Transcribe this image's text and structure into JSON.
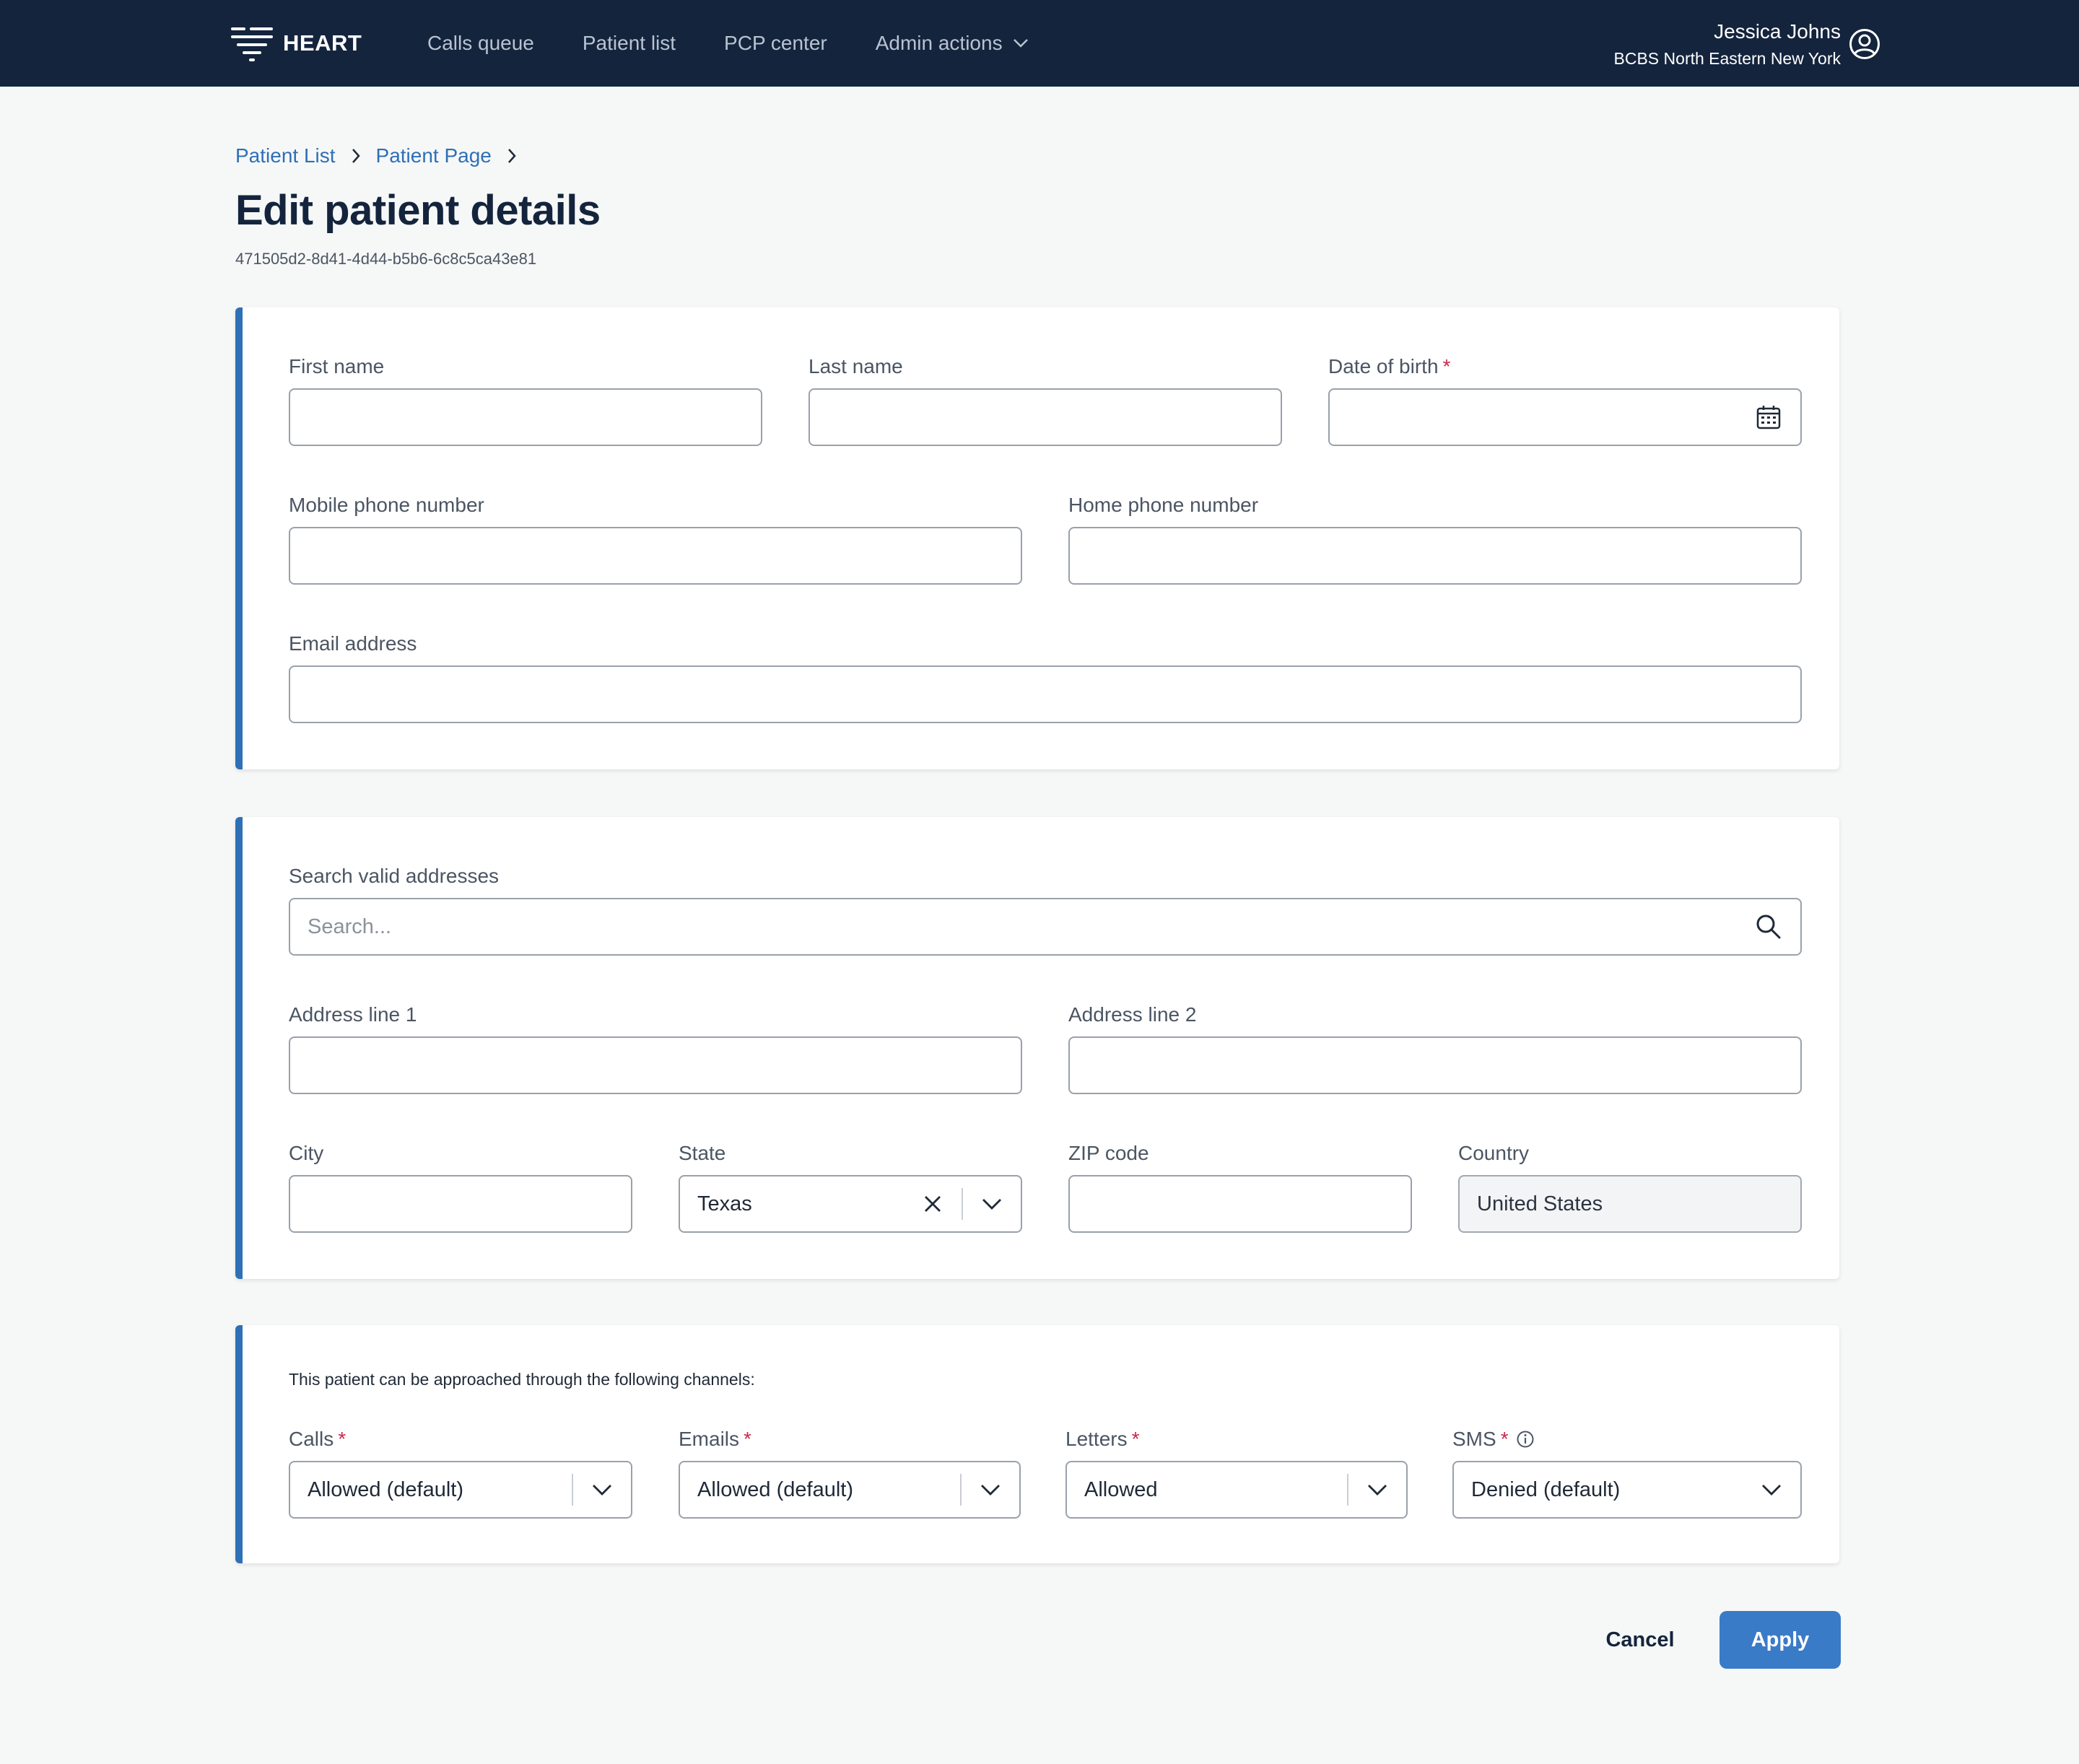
{
  "app": {
    "name": "HEART"
  },
  "nav": {
    "items": [
      {
        "label": "Calls queue"
      },
      {
        "label": "Patient list"
      },
      {
        "label": "PCP center"
      },
      {
        "label": "Admin actions"
      }
    ]
  },
  "user": {
    "name": "Jessica Johns",
    "org": "BCBS North Eastern New York"
  },
  "breadcrumb": {
    "items": [
      "Patient List",
      "Patient Page"
    ]
  },
  "page": {
    "title": "Edit patient details",
    "patient_id": "471505d2-8d41-4d44-b5b6-6c8c5ca43e81"
  },
  "personal": {
    "first_name": {
      "label": "First name",
      "value": ""
    },
    "last_name": {
      "label": "Last name",
      "value": ""
    },
    "dob": {
      "label": "Date of birth",
      "required": "*",
      "value": ""
    },
    "mobile": {
      "label": "Mobile phone number",
      "value": ""
    },
    "home": {
      "label": "Home phone number",
      "value": ""
    },
    "email": {
      "label": "Email address",
      "value": ""
    }
  },
  "address": {
    "search": {
      "label": "Search valid addresses",
      "placeholder": "Search..."
    },
    "line1": {
      "label": "Address line 1",
      "value": ""
    },
    "line2": {
      "label": "Address line 2",
      "value": ""
    },
    "city": {
      "label": "City",
      "value": ""
    },
    "state": {
      "label": "State",
      "value": "Texas"
    },
    "zip": {
      "label": "ZIP code",
      "value": ""
    },
    "country": {
      "label": "Country",
      "value": "United States"
    }
  },
  "channels": {
    "note": "This patient can be approached through the following channels:",
    "calls": {
      "label": "Calls",
      "required": "*",
      "value": "Allowed (default)"
    },
    "emails": {
      "label": "Emails",
      "required": "*",
      "value": "Allowed (default)"
    },
    "letters": {
      "label": "Letters",
      "required": "*",
      "value": "Allowed"
    },
    "sms": {
      "label": "SMS",
      "required": "*",
      "value": "Denied (default)"
    }
  },
  "actions": {
    "cancel": "Cancel",
    "apply": "Apply"
  },
  "colors": {
    "nav_bg": "#14243d",
    "accent": "#2f6fb6",
    "apply_bg": "#3a7bc8",
    "required": "#c9294b"
  }
}
